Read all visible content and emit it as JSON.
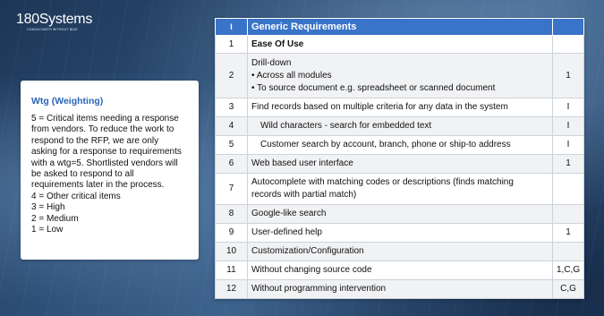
{
  "logo": {
    "brand": "180Systems",
    "tagline": "CONSULTANTS WITHOUT BIAS"
  },
  "card": {
    "title": "Wtg (Weighting)",
    "lines": [
      "5 = Critical items needing a response",
      "from vendors. To reduce the work to",
      "respond to the RFP, we are only",
      "asking for a response to requirements",
      "with a wtg=5. Shortlisted vendors will",
      "be asked to respond to all",
      "requirements later in the process.",
      "4 = Other critical items",
      "3 = High",
      "2 = Medium",
      "1 = Low"
    ]
  },
  "table": {
    "header": {
      "num": "I",
      "requirement": "Generic Requirements",
      "wtg": ""
    },
    "rows": [
      {
        "num": "1",
        "lines": [
          "Ease Of Use"
        ],
        "wtg": ""
      },
      {
        "num": "2",
        "lines": [
          "Drill-down",
          "• Across all modules",
          "• To source document e.g. spreadsheet or scanned document"
        ],
        "wtg": "1"
      },
      {
        "num": "3",
        "lines": [
          "Find records based on multiple criteria for any data in the system"
        ],
        "wtg": "I"
      },
      {
        "num": "4",
        "lines": [
          "Wild characters - search for embedded text"
        ],
        "wtg": "I"
      },
      {
        "num": "5",
        "lines": [
          "Customer search by account, branch, phone or ship-to address"
        ],
        "wtg": "I"
      },
      {
        "num": "6",
        "lines": [
          "Web based user interface"
        ],
        "wtg": "1"
      },
      {
        "num": "7",
        "lines": [
          "Autocomplete with matching codes or descriptions (finds matching",
          "records with partial match)"
        ],
        "wtg": ""
      },
      {
        "num": "8",
        "lines": [
          "Google-like search"
        ],
        "wtg": ""
      },
      {
        "num": "9",
        "lines": [
          "User-defined help"
        ],
        "wtg": "1"
      },
      {
        "num": "10",
        "lines": [
          "Customization/Configuration"
        ],
        "wtg": ""
      },
      {
        "num": "11",
        "lines": [
          "Without changing source code"
        ],
        "wtg": "1,C,G"
      },
      {
        "num": "12",
        "lines": [
          "Without programming intervention"
        ],
        "wtg": "C,G"
      }
    ]
  },
  "colors": {
    "header_blue": "#3a74c9",
    "title_blue": "#2a66b4",
    "background_navy": "#1d3656"
  }
}
